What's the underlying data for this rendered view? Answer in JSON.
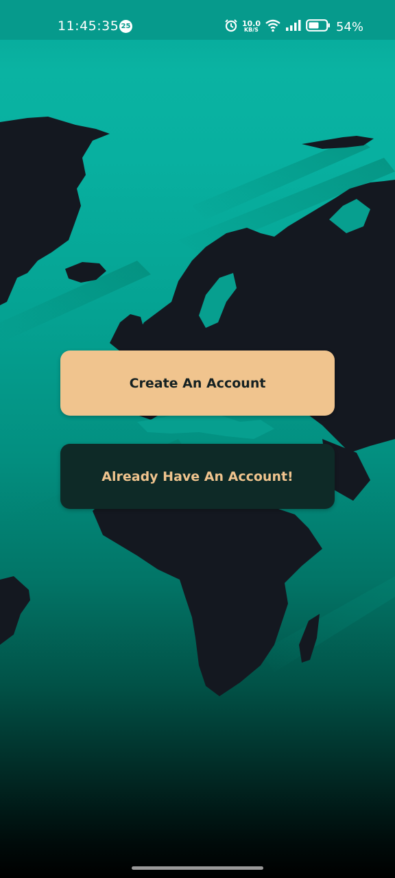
{
  "status_bar": {
    "time": "11:45:35",
    "notification_count": "25",
    "net_speed_value": "10.0",
    "net_speed_unit": "KB/S",
    "battery_percent": "54%",
    "icons": [
      "alarm-icon",
      "wifi-icon",
      "signal-icon",
      "battery-icon"
    ]
  },
  "actions": {
    "create_account_label": "Create An Account",
    "login_label": "Already Have An Account!"
  },
  "colors": {
    "primary_teal": "#069a8c",
    "accent_peach": "#f0c48e",
    "dark_button": "#0e2a27",
    "map_dark": "#141820"
  }
}
